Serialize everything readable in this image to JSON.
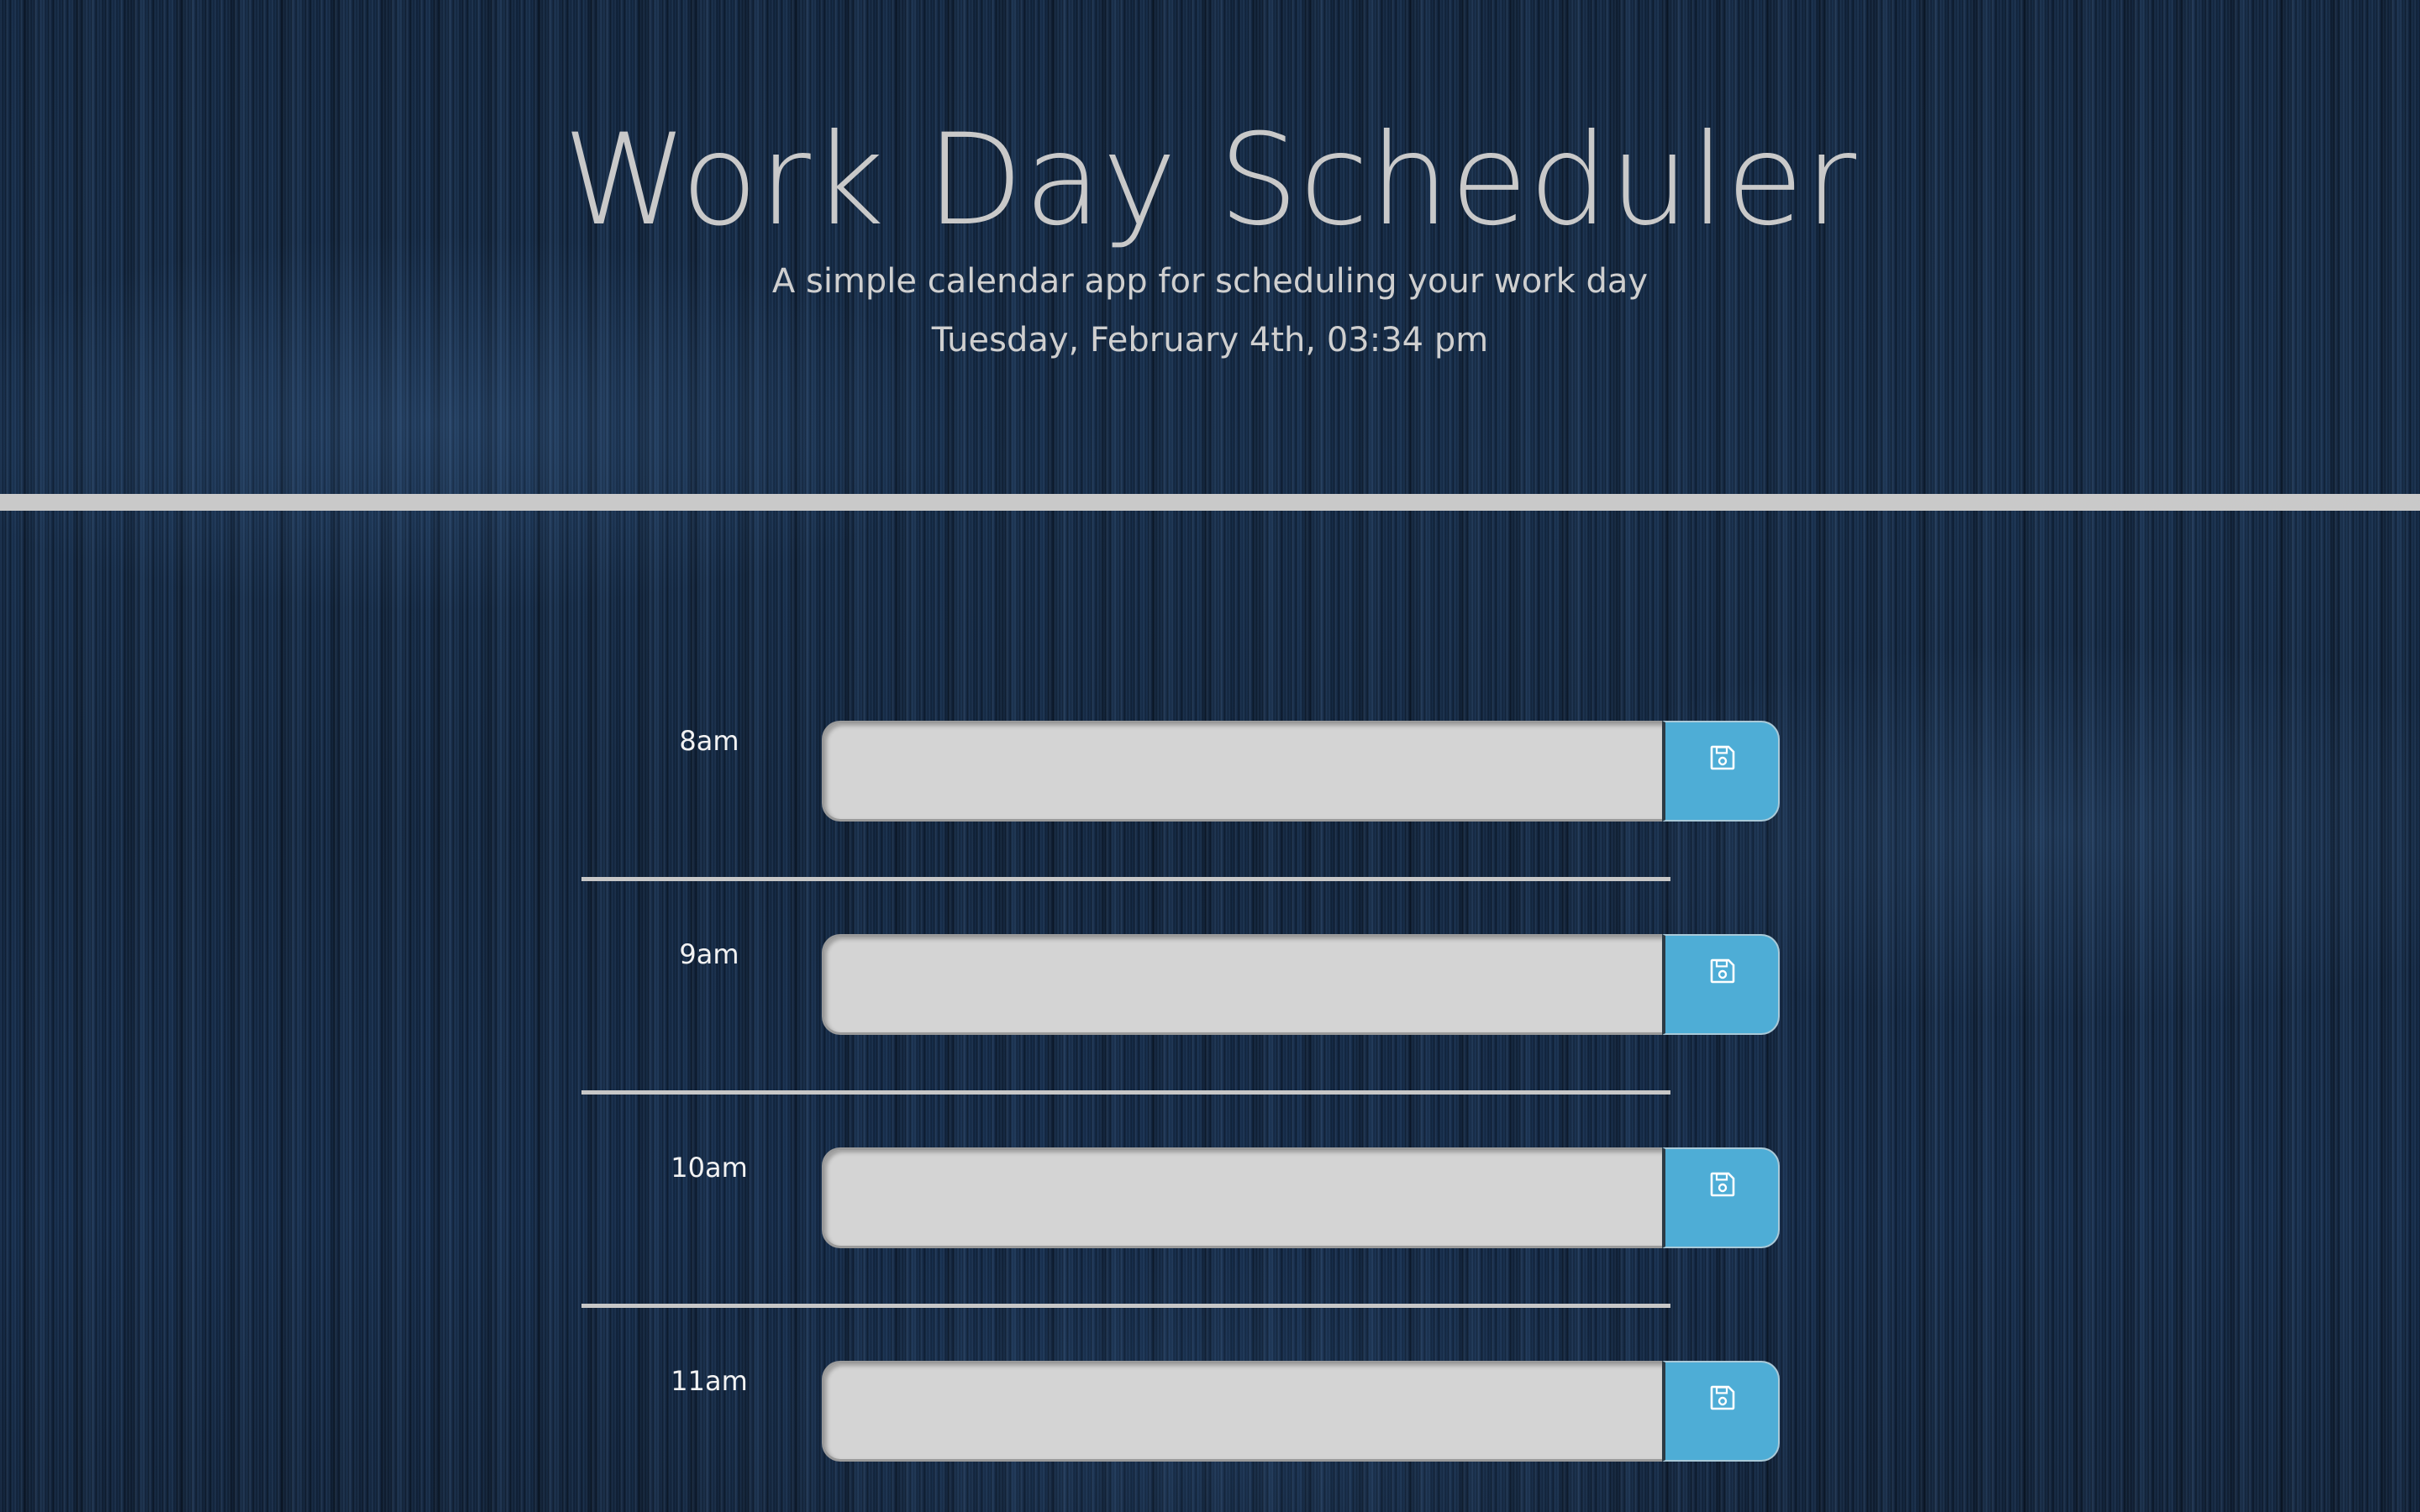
{
  "header": {
    "title": "Work Day Scheduler",
    "lead": "A simple calendar app for scheduling your work day",
    "current_day": "Tuesday, February 4th, 03:34 pm"
  },
  "schedule": {
    "time_blocks": [
      {
        "hour": "8am",
        "text": ""
      },
      {
        "hour": "9am",
        "text": ""
      },
      {
        "hour": "10am",
        "text": ""
      },
      {
        "hour": "11am",
        "text": ""
      }
    ],
    "save_icon": "floppy-disk-icon"
  },
  "colors": {
    "save_button": "#4eadd6",
    "input_background": "#d4d4d4",
    "divider": "#c7c7c7",
    "title_text": "#c9c9c9"
  }
}
